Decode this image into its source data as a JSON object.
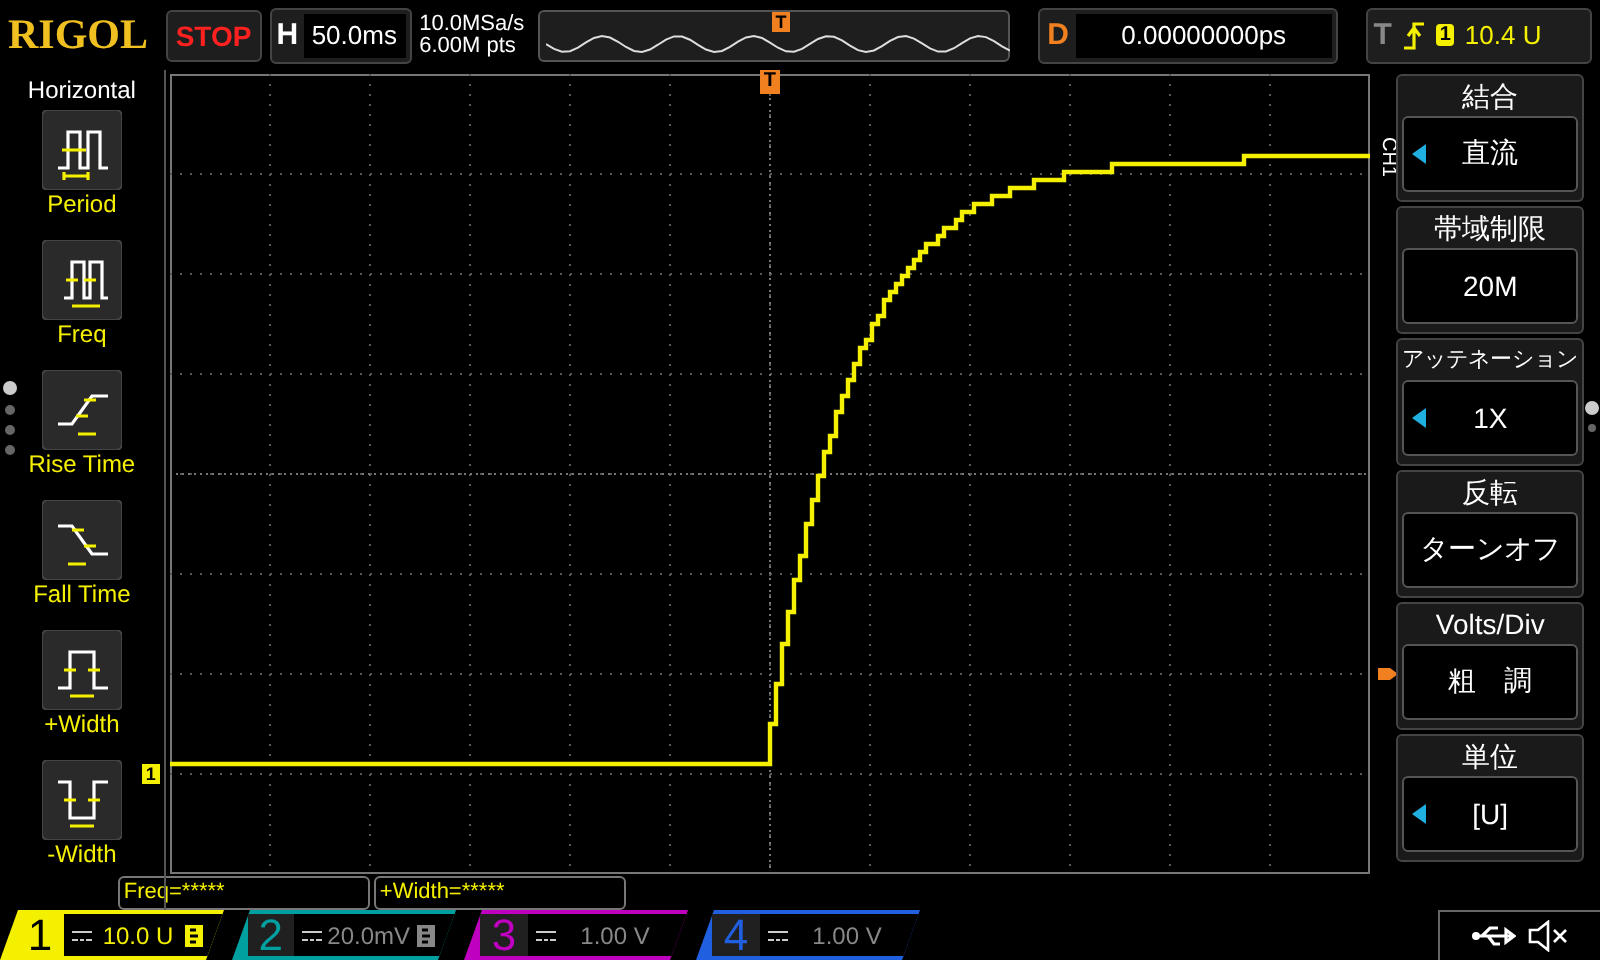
{
  "header": {
    "logo": "RIGOL",
    "run_state": "STOP",
    "timebase": {
      "label": "H",
      "value": "50.0ms"
    },
    "sample_rate": "10.0MSa/s",
    "memory_depth": "6.00M pts",
    "overview_marker": "T",
    "delay": {
      "label": "D",
      "value": "0.00000000ps"
    },
    "trigger": {
      "label": "T",
      "source": "1",
      "level": "10.4 U"
    }
  },
  "left_menu": {
    "title": "Horizontal",
    "items": [
      {
        "label": "Period",
        "kind": "period"
      },
      {
        "label": "Freq",
        "kind": "freq"
      },
      {
        "label": "Rise Time",
        "kind": "rise"
      },
      {
        "label": "Fall Time",
        "kind": "fall"
      },
      {
        "label": "+Width",
        "kind": "pos_width"
      },
      {
        "label": "-Width",
        "kind": "neg_width"
      }
    ]
  },
  "grid": {
    "trigger_marker": "T",
    "channel_marker": "1",
    "channel_label": "CH1"
  },
  "measurements": [
    "Freq=*****",
    "+Width=*****"
  ],
  "right_menu": [
    {
      "title": "結合",
      "value": "直流",
      "adjustable": true
    },
    {
      "title": "帯域制限",
      "value": "20M",
      "adjustable": false
    },
    {
      "title": "アッテネーション",
      "value": "1X",
      "adjustable": true
    },
    {
      "title": "反転",
      "value": "ターンオフ",
      "adjustable": false
    },
    {
      "title": "Volts/Div",
      "value": "粗　調",
      "adjustable": false
    },
    {
      "title": "単位",
      "value": "[U]",
      "adjustable": true
    }
  ],
  "channels": [
    {
      "number": "1",
      "scale": "10.0 U",
      "active": true,
      "bw_limit": true,
      "color": "#f5f000"
    },
    {
      "number": "2",
      "scale": "20.0mV",
      "active": false,
      "bw_limit": true,
      "color": "#00a0a0"
    },
    {
      "number": "3",
      "scale": "1.00 V",
      "active": false,
      "bw_limit": false,
      "color": "#c000c0"
    },
    {
      "number": "4",
      "scale": "1.00 V",
      "active": false,
      "bw_limit": false,
      "color": "#2060e0"
    }
  ]
}
